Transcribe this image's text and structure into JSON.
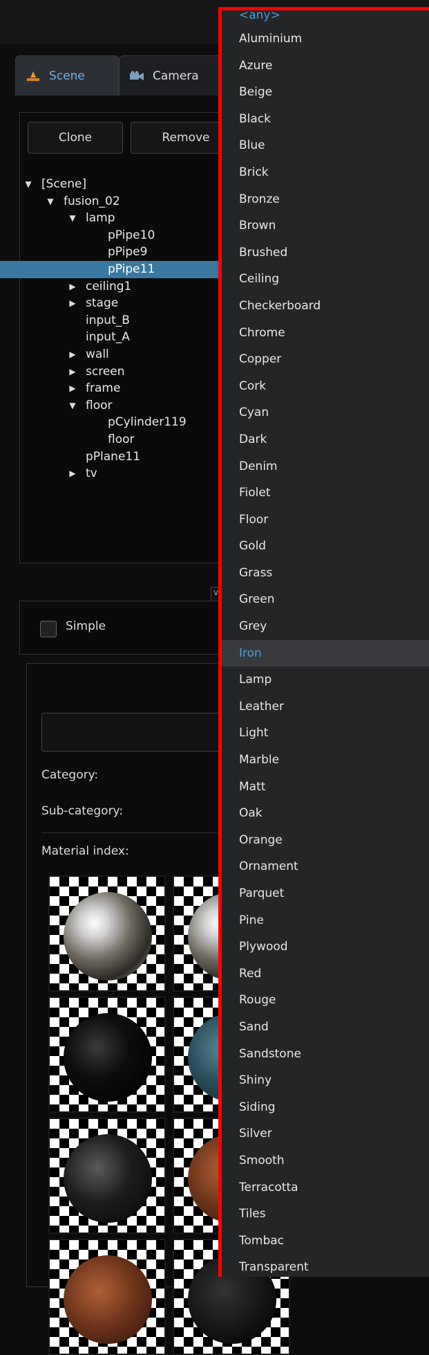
{
  "tabs": [
    {
      "label": "Scene",
      "icon": "scene-icon",
      "active": true
    },
    {
      "label": "Camera",
      "icon": "camera-icon",
      "active": false
    }
  ],
  "toolbar": {
    "clone_label": "Clone",
    "remove_label": "Remove"
  },
  "tree": [
    {
      "label": "[Scene]",
      "depth": 0,
      "toggle": "open"
    },
    {
      "label": "fusion_02",
      "depth": 1,
      "toggle": "open"
    },
    {
      "label": "lamp",
      "depth": 2,
      "toggle": "open"
    },
    {
      "label": "pPipe10",
      "depth": 3,
      "toggle": "none"
    },
    {
      "label": "pPipe9",
      "depth": 3,
      "toggle": "none"
    },
    {
      "label": "pPipe11",
      "depth": 3,
      "toggle": "none",
      "selected": true
    },
    {
      "label": "ceiling1",
      "depth": 2,
      "toggle": "closed"
    },
    {
      "label": "stage",
      "depth": 2,
      "toggle": "closed"
    },
    {
      "label": "input_B",
      "depth": 2,
      "toggle": "none"
    },
    {
      "label": "input_A",
      "depth": 2,
      "toggle": "none"
    },
    {
      "label": "wall",
      "depth": 2,
      "toggle": "closed"
    },
    {
      "label": "screen",
      "depth": 2,
      "toggle": "closed"
    },
    {
      "label": "frame",
      "depth": 2,
      "toggle": "closed"
    },
    {
      "label": "floor",
      "depth": 2,
      "toggle": "open"
    },
    {
      "label": "pCylinder119",
      "depth": 3,
      "toggle": "none"
    },
    {
      "label": "floor",
      "depth": 3,
      "toggle": "none"
    },
    {
      "label": "pPlane11",
      "depth": 2,
      "toggle": "none"
    },
    {
      "label": "tv",
      "depth": 2,
      "toggle": "closed"
    }
  ],
  "simple": {
    "label": "Simple",
    "checked": false
  },
  "materials": {
    "category_label": "Category:",
    "subcategory_label": "Sub-category:",
    "index_label": "Material index:",
    "thumbnails": [
      {
        "material": "chrome"
      },
      {
        "material": "chrome"
      },
      {
        "material": "black"
      },
      {
        "material": "teal"
      },
      {
        "material": "dark-grey"
      },
      {
        "material": "brown"
      },
      {
        "material": "brown"
      },
      {
        "material": "dark"
      }
    ]
  },
  "dropdown": {
    "first_option": "<any>",
    "highlighted": "Iron",
    "options": [
      "Aluminium",
      "Azure",
      "Beige",
      "Black",
      "Blue",
      "Brick",
      "Bronze",
      "Brown",
      "Brushed",
      "Ceiling",
      "Checkerboard",
      "Chrome",
      "Copper",
      "Cork",
      "Cyan",
      "Dark",
      "Denim",
      "Fiolet",
      "Floor",
      "Gold",
      "Grass",
      "Green",
      "Grey",
      "Iron",
      "Lamp",
      "Leather",
      "Light",
      "Marble",
      "Matt",
      "Oak",
      "Orange",
      "Ornament",
      "Parquet",
      "Pine",
      "Plywood",
      "Red",
      "Rouge",
      "Sand",
      "Sandstone",
      "Shiny",
      "Siding",
      "Silver",
      "Smooth",
      "Terracotta",
      "Tiles",
      "Tombac",
      "Transparent"
    ]
  },
  "colors": {
    "accent": "#4a9fd8",
    "selection": "#3a78a0",
    "outline": "#ff0000"
  }
}
